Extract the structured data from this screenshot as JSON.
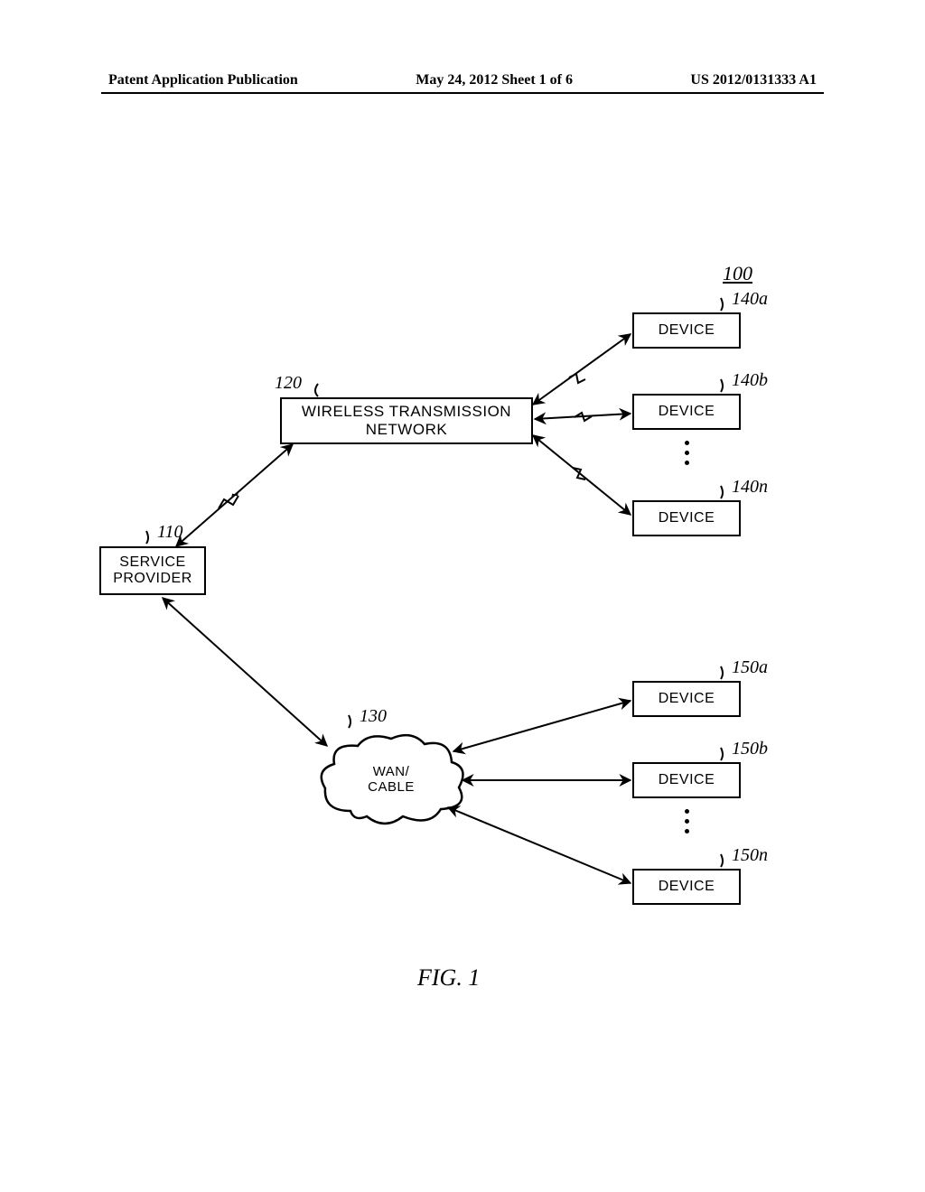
{
  "header": {
    "left": "Patent Application Publication",
    "center": "May 24, 2012  Sheet 1 of 6",
    "right": "US 2012/0131333 A1"
  },
  "system_ref": "100",
  "nodes": {
    "service_provider": {
      "label": "SERVICE\nPROVIDER",
      "ref": "110"
    },
    "wireless_network": {
      "label": "WIRELESS TRANSMISSION\nNETWORK",
      "ref": "120"
    },
    "wan_cable": {
      "label": "WAN/ CABLE",
      "ref": "130"
    },
    "devices_wireless": [
      {
        "label": "DEVICE",
        "ref": "140a"
      },
      {
        "label": "DEVICE",
        "ref": "140b"
      },
      {
        "label": "DEVICE",
        "ref": "140n"
      }
    ],
    "devices_wan": [
      {
        "label": "DEVICE",
        "ref": "150a"
      },
      {
        "label": "DEVICE",
        "ref": "150b"
      },
      {
        "label": "DEVICE",
        "ref": "150n"
      }
    ]
  },
  "figure_caption": "FIG. 1"
}
